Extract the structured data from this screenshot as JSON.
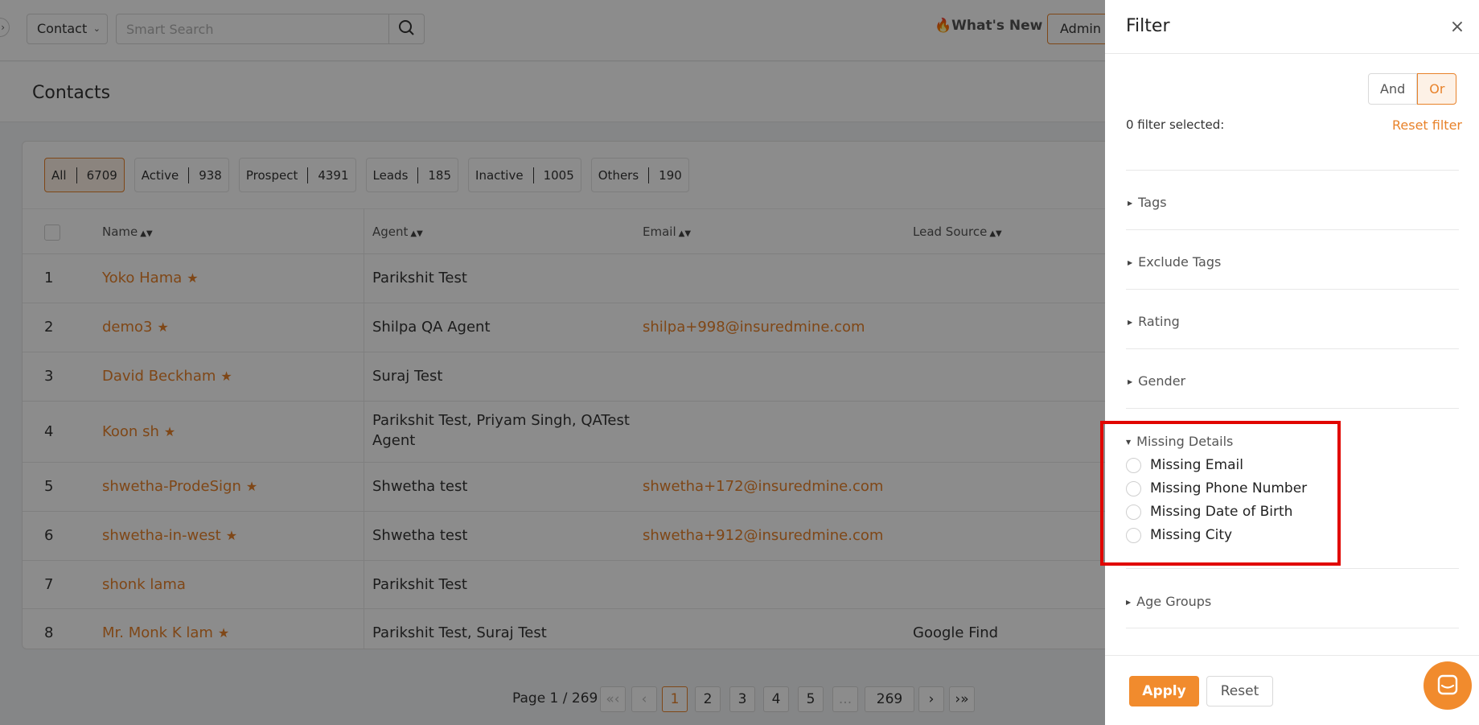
{
  "header": {
    "collapse_glyph": "›",
    "module": "Contact",
    "search_placeholder": "Smart Search",
    "whats_new": "What's New",
    "whats_new_emoji": "🔥",
    "admin": "Admin"
  },
  "page": {
    "title": "Contacts"
  },
  "stat_tabs": [
    {
      "label": "All",
      "count": "6709",
      "active": true
    },
    {
      "label": "Active",
      "count": "938"
    },
    {
      "label": "Prospect",
      "count": "4391"
    },
    {
      "label": "Leads",
      "count": "185"
    },
    {
      "label": "Inactive",
      "count": "1005"
    },
    {
      "label": "Others",
      "count": "190"
    }
  ],
  "table": {
    "columns": [
      "Name",
      "Agent",
      "Email",
      "Lead Source"
    ],
    "rows": [
      {
        "num": "1",
        "name": "Yoko Hama",
        "starred": true,
        "agent": "Parikshit Test",
        "email": "",
        "lead_source": ""
      },
      {
        "num": "2",
        "name": "demo3",
        "starred": true,
        "agent": "Shilpa QA Agent",
        "email": "shilpa+998@insuredmine.com",
        "lead_source": ""
      },
      {
        "num": "3",
        "name": "David Beckham",
        "starred": true,
        "agent": "Suraj Test",
        "email": "",
        "lead_source": ""
      },
      {
        "num": "4",
        "name": "Koon sh",
        "starred": true,
        "agent_line1": "Parikshit Test, Priyam Singh, QATest",
        "agent_line2": "Agent",
        "email": "",
        "lead_source": ""
      },
      {
        "num": "5",
        "name": "shwetha-ProdeSign",
        "starred": true,
        "agent": "Shwetha test",
        "email": "shwetha+172@insuredmine.com",
        "lead_source": ""
      },
      {
        "num": "6",
        "name": "shwetha-in-west",
        "starred": true,
        "agent": "Shwetha test",
        "email": "shwetha+912@insuredmine.com",
        "lead_source": ""
      },
      {
        "num": "7",
        "name": "shonk lama",
        "starred": false,
        "agent": "Parikshit Test",
        "email": "",
        "lead_source": ""
      },
      {
        "num": "8",
        "name": "Mr. Monk K lam",
        "starred": true,
        "agent": "Parikshit Test, Suraj Test",
        "email": "",
        "lead_source": "Google Find"
      }
    ]
  },
  "pagination": {
    "info": "Page 1 / 269",
    "first": "«‹",
    "prev": "‹",
    "pages": [
      "1",
      "2",
      "3",
      "4",
      "5",
      "...",
      "269"
    ],
    "current": "1",
    "next": "›",
    "last": "›»"
  },
  "filter": {
    "title": "Filter",
    "close_glyph": "×",
    "logic_and": "And",
    "logic_or": "Or",
    "selected_count": "0 filter selected:",
    "reset_filter": "Reset filter",
    "sections": [
      "Tags",
      "Exclude Tags",
      "Rating",
      "Gender",
      "Missing Details",
      "Age Groups"
    ],
    "missing_details_options": [
      "Missing Email",
      "Missing Phone Number",
      "Missing Date of Birth",
      "Missing City"
    ],
    "apply": "Apply",
    "reset": "Reset"
  },
  "colors": {
    "accent": "#f18b2d",
    "highlight": "#e10600"
  }
}
